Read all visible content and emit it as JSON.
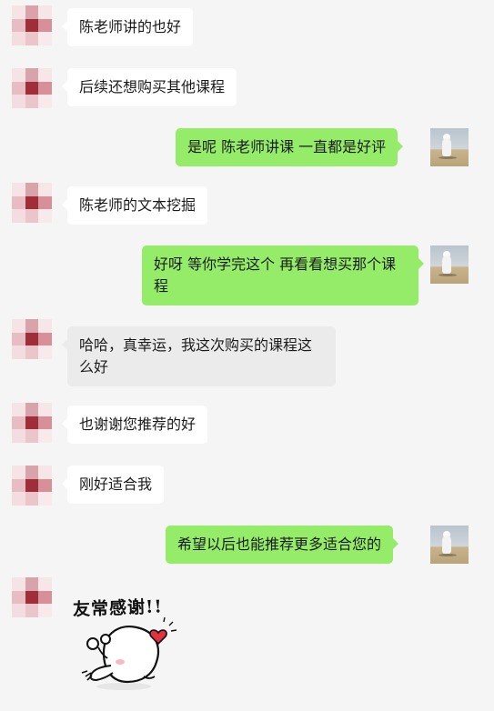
{
  "messages": [
    {
      "dir": "in",
      "text": "陈老师讲的也好"
    },
    {
      "dir": "in",
      "text": "后续还想购买其他课程"
    },
    {
      "dir": "out",
      "text": "是呢 陈老师讲课 一直都是好评"
    },
    {
      "dir": "in",
      "text": "陈老师的文本挖掘"
    },
    {
      "dir": "out",
      "text": "好呀 等你学完这个 再看看想买那个课程"
    },
    {
      "dir": "in",
      "text": "哈哈，真幸运，我这次购买的课程这么好",
      "selected": true
    },
    {
      "dir": "in",
      "text": "也谢谢您推荐的好"
    },
    {
      "dir": "in",
      "text": "刚好适合我"
    },
    {
      "dir": "out",
      "text": "希望以后也能推荐更多适合您的"
    },
    {
      "dir": "in",
      "sticker": "heart-thanks-sticker",
      "text": "友常感谢!!"
    }
  ],
  "colors": {
    "background": "#f5f5f5",
    "incoming_bubble": "#ffffff",
    "outgoing_bubble": "#95ec69",
    "selected_bubble": "#ebebeb",
    "mosaic_light": "#f1d6da",
    "mosaic_mid": "#d9a3ab",
    "mosaic_dark": "#9e2f3a"
  }
}
